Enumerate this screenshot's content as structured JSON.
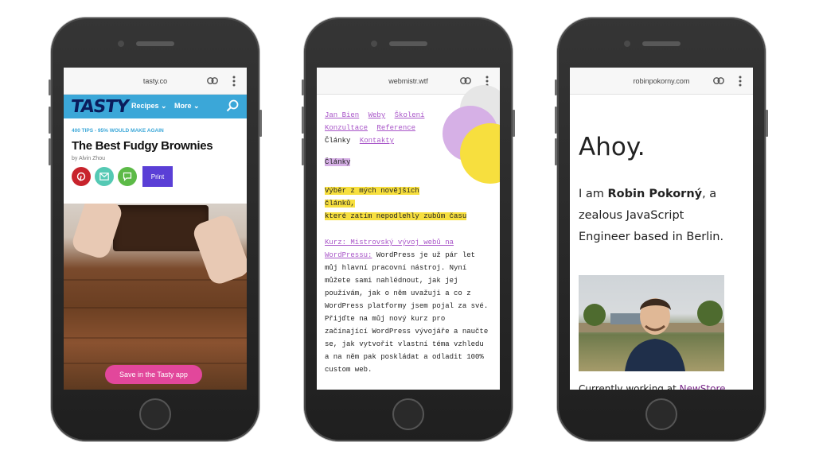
{
  "phones": [
    {
      "url": "tasty.co",
      "nav": {
        "logo": "TASTY",
        "menu": [
          "Recipes ⌄",
          "More ⌄"
        ]
      },
      "tips": "400 TIPS - 95% WOULD MAKE AGAIN",
      "title": "The Best Fudgy Brownies",
      "author": "by Alvin Zhou",
      "print_label": "Print",
      "save_app_label": "Save in the Tasty app",
      "icons": [
        "pinterest-icon",
        "email-icon",
        "comment-icon",
        "search-icon"
      ],
      "colors": {
        "nav": "#3ba7d8",
        "pinterest": "#c8232c",
        "email": "#55c9b4",
        "comment": "#5cba47",
        "print": "#5a3fd6",
        "save": "#e2479b"
      }
    },
    {
      "url": "webmistr.wtf",
      "nav": [
        "Jan Bien",
        "Weby",
        "Školení",
        "Konzultace",
        "Reference",
        "Články",
        "Kontakty"
      ],
      "section_heading": "Články",
      "tagline": [
        "Výběr z mých novějších",
        "článků,",
        "které zatím nepodlehly zubům času"
      ],
      "article_link": "Kurz: Mistrovský vývoj webů na WordPressu:",
      "article_text": " WordPress je už pár let můj hlavní pracovní nástroj. Nyní můžete sami nahlédnout, jak jej používám, jak o něm uvažuji a co z WordPress platformy jsem pojal za své. Přijďte na můj nový kurz pro začínající WordPress vývojáře a naučte se, jak vytvořit vlastní téma vzhledu a na něm pak poskládat a odladit 100% custom web.",
      "colors": {
        "link": "#a855c8",
        "highlight": "#d6b0e6",
        "yellow": "#f7df3e"
      }
    },
    {
      "url": "robinpokorny.com",
      "greeting": "Ahoy.",
      "intro_pre": "I am ",
      "intro_name": "Robin Pokorný",
      "intro_post": ", a zealous JavaScript Engineer based in Berlin.",
      "working_pre": "Currently working at ",
      "working_link": "NewStore",
      "colors": {
        "link": "#7a2a8a"
      }
    }
  ]
}
